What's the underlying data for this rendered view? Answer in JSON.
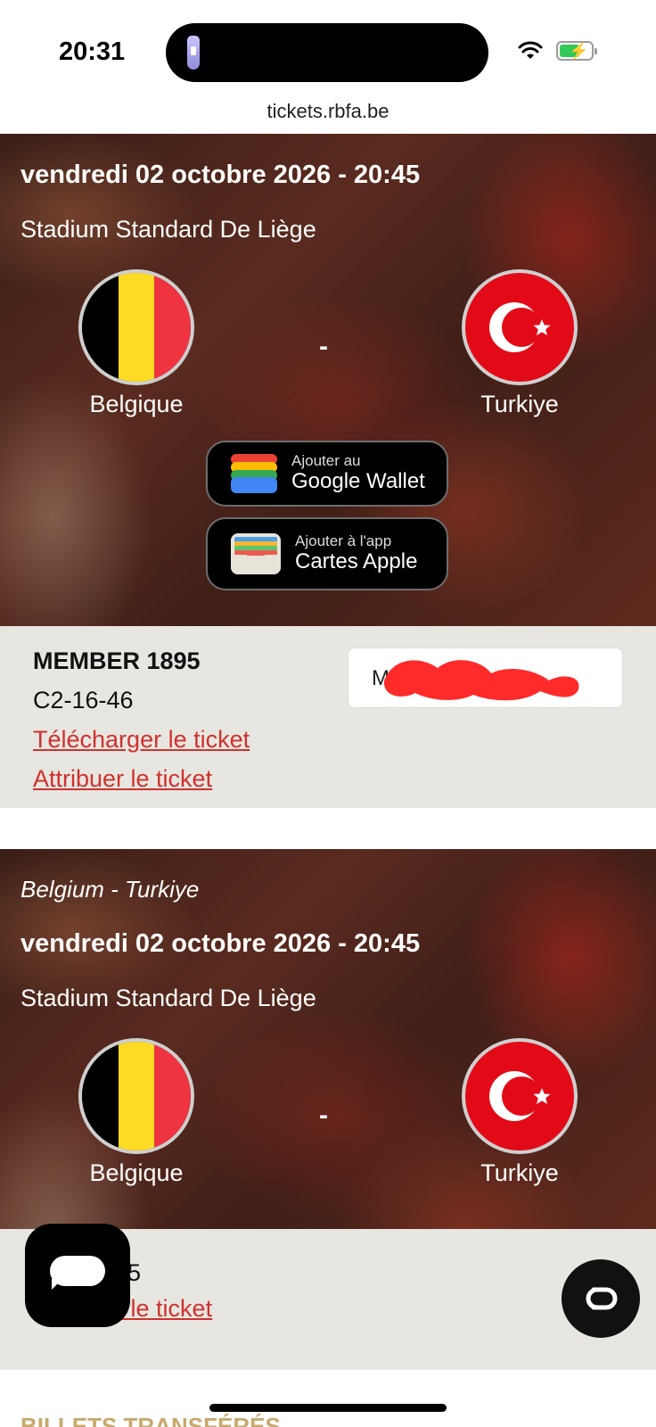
{
  "status_bar": {
    "time": "20:31",
    "battery_charging": true
  },
  "browser": {
    "url": "tickets.rbfa.be"
  },
  "tickets": [
    {
      "subtitle": "",
      "date": "vendredi 02 octobre 2026 - 20:45",
      "venue": "Stadium Standard De Liège",
      "home_team": "Belgique",
      "away_team": "Turkiye",
      "separator": "-",
      "google_wallet": {
        "small": "Ajouter au",
        "big": "Google Wallet"
      },
      "apple_wallet": {
        "small": "Ajouter à l'app",
        "big": "Cartes Apple"
      },
      "member": "MEMBER 1895",
      "seat": "C2-16-46",
      "download_link": "Télécharger le ticket",
      "assign_link": "Attribuer le ticket",
      "holder_initial": "M"
    },
    {
      "subtitle": "Belgium - Turkiye",
      "date": "vendredi 02 octobre 2026 - 20:45",
      "venue": "Stadium Standard De Liège",
      "home_team": "Belgique",
      "away_team": "Turkiye",
      "separator": "-",
      "seat_partial": "45",
      "assign_link": "Attribuer le ticket"
    }
  ],
  "section_heading": "BILLETS TRANSFÉRÉS",
  "colors": {
    "link": "#d0312d",
    "panel": "#e7e6e1",
    "heading": "#c8a96e",
    "turkey_red": "#e30a17",
    "belgium_black": "#000000",
    "belgium_yellow": "#fdda24",
    "belgium_red": "#ef3340"
  },
  "icons": {
    "chat": "chat-bubble-icon",
    "cc": "closed-caption-icon",
    "google_wallet": "google-wallet-icon",
    "apple_wallet": "apple-wallet-icon"
  }
}
